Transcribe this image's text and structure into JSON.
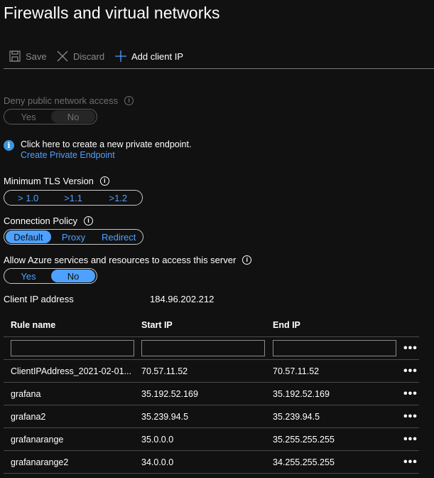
{
  "page": {
    "title": "Firewalls and virtual networks"
  },
  "toolbar": {
    "save_label": "Save",
    "discard_label": "Discard",
    "add_client_ip_label": "Add client IP",
    "icons": {
      "save": "save-icon",
      "discard": "close-icon",
      "add": "plus-icon"
    }
  },
  "deny_public": {
    "label": "Deny public network access",
    "options": [
      "Yes",
      "No"
    ],
    "selected": "No",
    "disabled": true
  },
  "private_endpoint": {
    "message": "Click here to create a new private endpoint.",
    "link": "Create Private Endpoint"
  },
  "tls": {
    "label": "Minimum TLS Version",
    "options": [
      "> 1.0",
      ">1.1",
      ">1.2"
    ],
    "selected": null
  },
  "connection_policy": {
    "label": "Connection Policy",
    "options": [
      "Default",
      "Proxy",
      "Redirect"
    ],
    "selected": "Default"
  },
  "allow_azure": {
    "label": "Allow Azure services and resources to access this server",
    "options": [
      "Yes",
      "No"
    ],
    "selected": "No"
  },
  "client_ip": {
    "label": "Client IP address",
    "value": "184.96.202.212"
  },
  "rules_table": {
    "headers": [
      "Rule name",
      "Start IP",
      "End IP"
    ],
    "more_label": "•••",
    "rows": [
      {
        "name": "ClientIPAddress_2021-02-01...",
        "start": "70.57.11.52",
        "end": "70.57.11.52"
      },
      {
        "name": "grafana",
        "start": "35.192.52.169",
        "end": "35.192.52.169"
      },
      {
        "name": "grafana2",
        "start": "35.239.94.5",
        "end": "35.239.94.5"
      },
      {
        "name": "grafanarange",
        "start": "35.0.0.0",
        "end": "35.255.255.255"
      },
      {
        "name": "grafanarange2",
        "start": "34.0.0.0",
        "end": "34.255.255.255"
      }
    ]
  }
}
